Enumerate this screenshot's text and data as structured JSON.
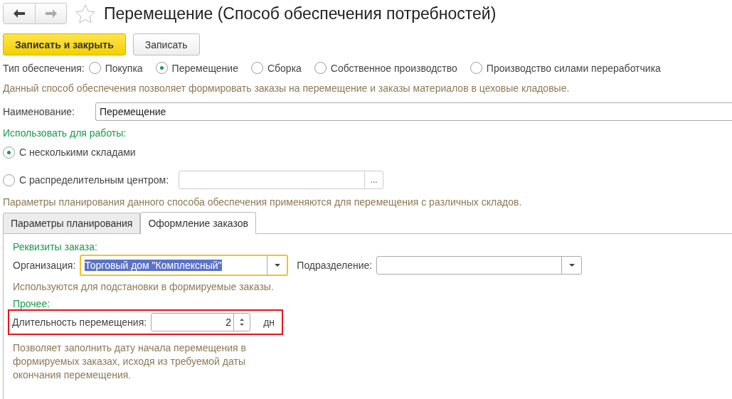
{
  "window": {
    "title": "Перемещение (Способ обеспечения потребностей)"
  },
  "toolbar": {
    "buttons": [
      {
        "label": "Записать и закрыть",
        "kind": "primary"
      },
      {
        "label": "Записать",
        "kind": "default"
      }
    ]
  },
  "supply_type": {
    "label": "Тип обеспечения:",
    "options": [
      {
        "label": "Покупка",
        "selected": false
      },
      {
        "label": "Перемещение",
        "selected": true
      },
      {
        "label": "Сборка",
        "selected": false
      },
      {
        "label": "Собственное производство",
        "selected": false
      },
      {
        "label": "Производство силами переработчика",
        "selected": false
      }
    ]
  },
  "supply_note": "Данный способ обеспечения позволяет формировать заказы на перемещение и заказы материалов в цеховые кладовые.",
  "name_field": {
    "label": "Наименование:",
    "value": "Перемещение"
  },
  "usage": {
    "heading": "Использовать для работы:",
    "options": [
      {
        "label": "С несколькими складами",
        "selected": true,
        "kind": "plain"
      },
      {
        "label": "С распределительным центром:",
        "selected": false,
        "kind": "with_field",
        "button": "..."
      }
    ]
  },
  "planning_note": "Параметры планирования данного способа обеспечения применяются для перемещения с различных складов.",
  "tabs": [
    {
      "label": "Параметры планирования",
      "selected": false
    },
    {
      "label": "Оформление заказов",
      "selected": true
    }
  ],
  "order_details": {
    "heading": "Реквизиты заказа:",
    "organization": {
      "label": "Организация:",
      "value": "Торговый дом \"Комплексный\"",
      "focused": true
    },
    "department": {
      "label": "Подразделение:"
    },
    "note": "Используются для подстановки в формируемые заказы."
  },
  "other": {
    "heading": "Прочее:",
    "duration": {
      "label": "Длительность перемещения:",
      "value": "2",
      "unit": "дн",
      "highlighted": true
    },
    "note": "Позволяет заполнить дату начала перемещения в формируемых заказах, исходя из требуемой даты окончания перемещения."
  }
}
